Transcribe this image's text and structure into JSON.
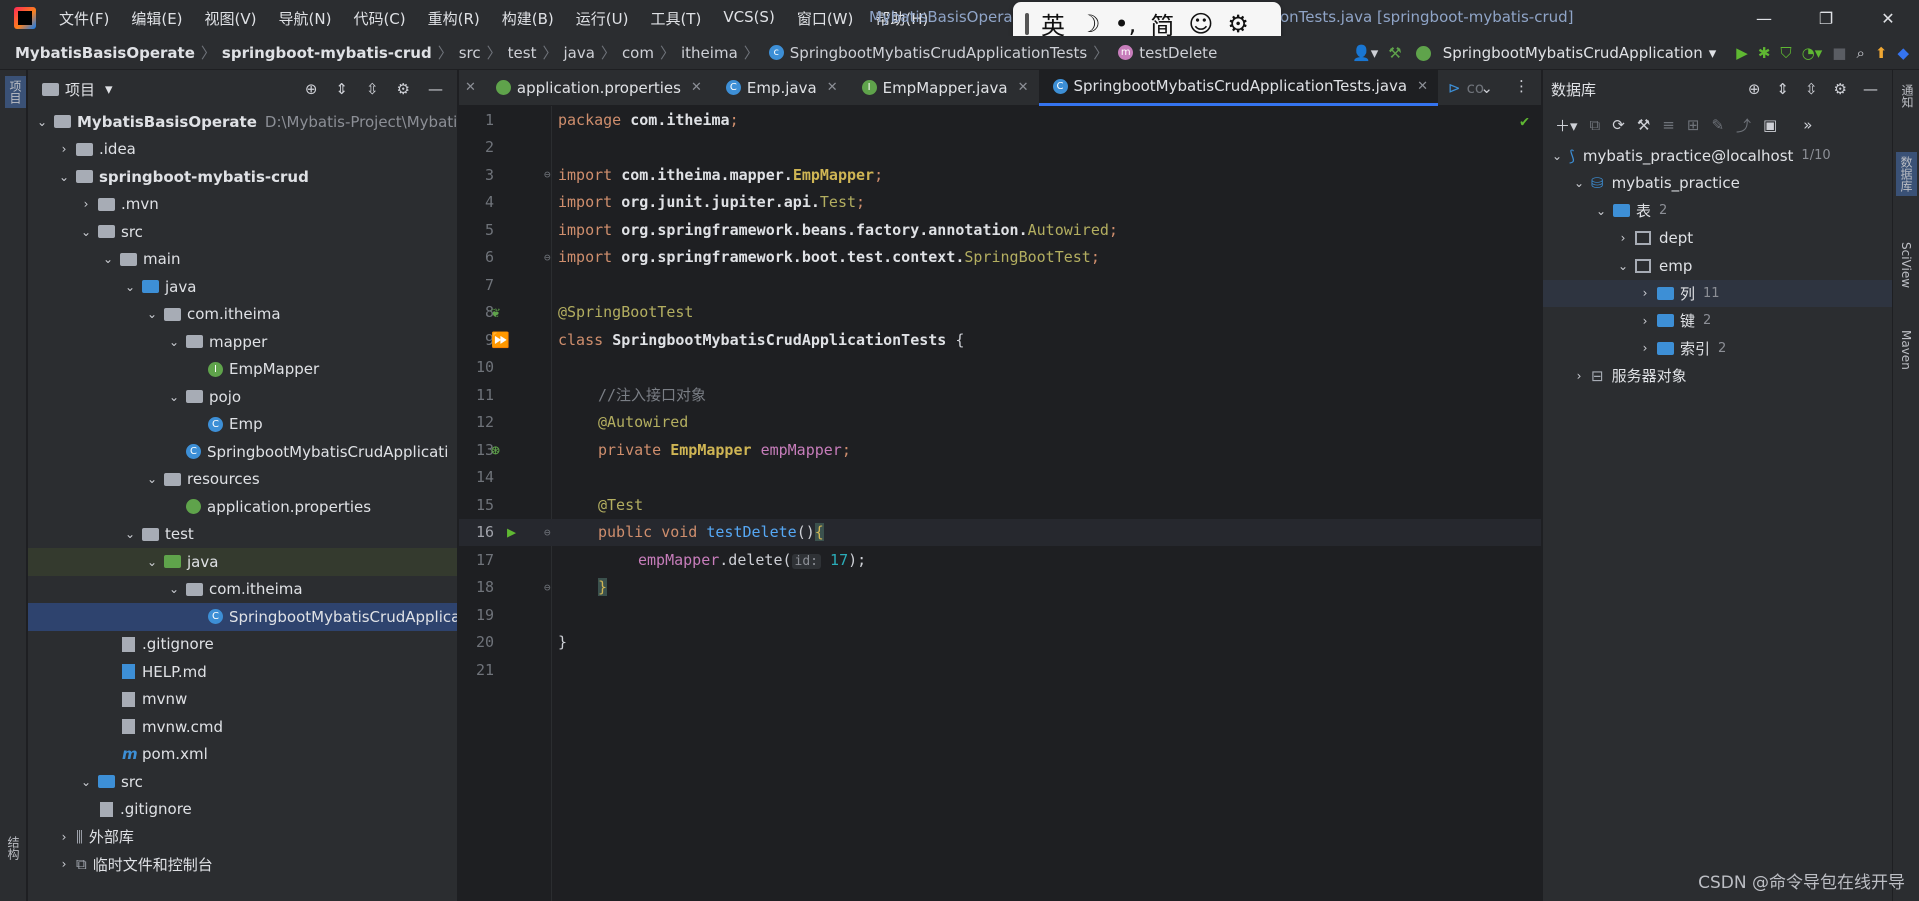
{
  "menu": [
    "文件(F)",
    "编辑(E)",
    "视图(V)",
    "导航(N)",
    "代码(C)",
    "重构(R)",
    "构建(B)",
    "运行(U)",
    "工具(T)",
    "VCS(S)",
    "窗口(W)",
    "帮助(H)"
  ],
  "window_title_left": "MybatisBasisOperate",
  "window_title_right": "onTests.java [springboot-mybatis-crud]",
  "ime": {
    "lang": "英",
    "moon": "☽",
    "punct": "•,",
    "mode": "简",
    "emoji": "☺",
    "settings": "⚙"
  },
  "breadcrumb": [
    "MybatisBasisOperate",
    "springboot-mybatis-crud",
    "src",
    "test",
    "java",
    "com",
    "itheima",
    "SpringbootMybatisCrudApplicationTests",
    "testDelete"
  ],
  "run_config": "SpringbootMybatisCrudApplication",
  "left_strip": {
    "project": "项目",
    "structure": "结构"
  },
  "right_strip": {
    "notifications": "通知",
    "database": "数据库",
    "sciview": "SciView",
    "maven": "Maven"
  },
  "project_panel": {
    "title": "项目",
    "tree": [
      {
        "label": "MybatisBasisOperate",
        "extra": "D:\\Mybatis-Project\\MybatisBa",
        "bold": true
      },
      {
        "label": ".idea"
      },
      {
        "label": "springboot-mybatis-crud",
        "bold": true
      },
      {
        "label": ".mvn"
      },
      {
        "label": "src"
      },
      {
        "label": "main"
      },
      {
        "label": "java"
      },
      {
        "label": "com.itheima"
      },
      {
        "label": "mapper"
      },
      {
        "label": "EmpMapper"
      },
      {
        "label": "pojo"
      },
      {
        "label": "Emp"
      },
      {
        "label": "SpringbootMybatisCrudApplicati"
      },
      {
        "label": "resources"
      },
      {
        "label": "application.properties"
      },
      {
        "label": "test"
      },
      {
        "label": "java"
      },
      {
        "label": "com.itheima"
      },
      {
        "label": "SpringbootMybatisCrudApplicati"
      },
      {
        "label": ".gitignore"
      },
      {
        "label": "HELP.md"
      },
      {
        "label": "mvnw"
      },
      {
        "label": "mvnw.cmd"
      },
      {
        "label": "pom.xml"
      },
      {
        "label": "src"
      },
      {
        "label": ".gitignore"
      },
      {
        "label": "外部库"
      },
      {
        "label": "临时文件和控制台"
      }
    ]
  },
  "editor_tabs": [
    {
      "label": "application.properties"
    },
    {
      "label": "Emp.java"
    },
    {
      "label": "EmpMapper.java"
    },
    {
      "label": "SpringbootMybatisCrudApplicationTests.java",
      "active": true
    },
    {
      "label": "co"
    }
  ],
  "code": {
    "line_numbers": [
      "1",
      "2",
      "3",
      "4",
      "5",
      "6",
      "7",
      "8",
      "9",
      "10",
      "11",
      "12",
      "13",
      "14",
      "15",
      "16",
      "17",
      "18",
      "19",
      "20",
      "21"
    ],
    "current_line": "16",
    "l1a": "package ",
    "l1b": "com.itheima",
    "l1c": ";",
    "l3a": "import ",
    "l3b": "com.itheima.mapper.",
    "l3c": "EmpMapper",
    "l3d": ";",
    "l4a": "import ",
    "l4b": "org.junit.jupiter.api.",
    "l4c": "Test",
    "l4d": ";",
    "l5a": "import ",
    "l5b": "org.springframework.beans.factory.annotation.",
    "l5c": "Autowired",
    "l5d": ";",
    "l6a": "import ",
    "l6b": "org.springframework.boot.test.context.",
    "l6c": "SpringBootTest",
    "l6d": ";",
    "l8": "@SpringBootTest",
    "l9a": "class ",
    "l9b": "SpringbootMybatisCrudApplicationTests",
    "l9c": " {",
    "l11": "//注入接口对象",
    "l12": "@Autowired",
    "l13a": "private ",
    "l13b": "EmpMapper ",
    "l13c": "empMapper",
    "l13d": ";",
    "l15": "@Test",
    "l16a": "public void ",
    "l16b": "testDelete",
    "l16c": "()",
    "l16d": "{",
    "l17a": "empMapper",
    "l17b": ".delete(",
    "l17hint": "id:",
    "l17c": "17",
    "l17d": ");",
    "l18": "}",
    "l20": "}"
  },
  "db_panel": {
    "title": "数据库",
    "tree": [
      {
        "label": "mybatis_practice@localhost",
        "count": "1/10"
      },
      {
        "label": "mybatis_practice"
      },
      {
        "label": "表",
        "count": "2"
      },
      {
        "label": "dept"
      },
      {
        "label": "emp"
      },
      {
        "label": "列",
        "count": "11"
      },
      {
        "label": "键",
        "count": "2"
      },
      {
        "label": "索引",
        "count": "2"
      },
      {
        "label": "服务器对象"
      }
    ]
  },
  "watermark": "CSDN @命令导包在线开导"
}
